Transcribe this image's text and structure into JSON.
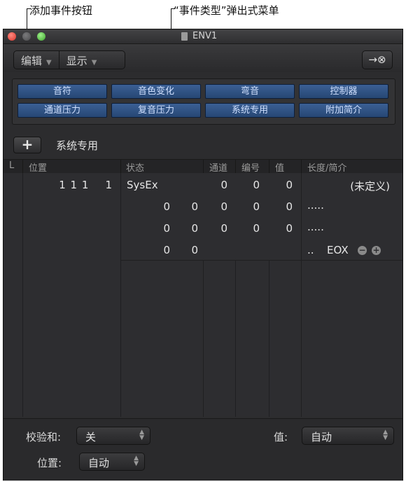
{
  "callouts": {
    "add_event": "添加事件按钮",
    "event_type": "“事件类型”弹出式菜单"
  },
  "window": {
    "title": "ENV1",
    "icons": {
      "close": "close-icon",
      "minimize": "minimize-icon",
      "zoom": "zoom-icon",
      "doc": "document-icon"
    }
  },
  "toolbar": {
    "edit_label": "编辑",
    "view_label": "显示",
    "catch_icon": "→⊗"
  },
  "filters": [
    [
      "音符",
      "音色变化",
      "弯音",
      "控制器"
    ],
    [
      "通道压力",
      "复音压力",
      "系统专用",
      "附加简介"
    ]
  ],
  "event_type": {
    "add_label": "+",
    "current": "系统专用"
  },
  "list": {
    "columns": [
      "L",
      "位置",
      "状态",
      "通道",
      "编号",
      "值",
      "长度/简介"
    ],
    "rows": [
      {
        "position": "1 1 1    1",
        "status": "SysEx",
        "channel": "0",
        "number": "0",
        "value": "0",
        "length": "(未定义)"
      },
      {
        "a": "0",
        "b": "0",
        "channel": "0",
        "number": "0",
        "value": "0",
        "length": "....."
      },
      {
        "a": "0",
        "b": "0",
        "channel": "0",
        "number": "0",
        "value": "0",
        "length": "....."
      },
      {
        "a": "0",
        "b": "0",
        "dots": "..",
        "eox": "EOX",
        "minus": "−",
        "plus": "+"
      }
    ]
  },
  "footer": {
    "checksum_label": "校验和:",
    "checksum_value": "关",
    "value_label": "值:",
    "value_value": "自动",
    "position_label": "位置:",
    "position_value": "自动"
  }
}
